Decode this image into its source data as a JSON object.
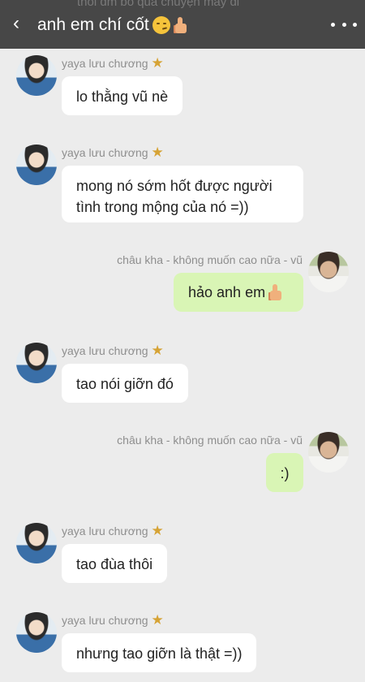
{
  "header": {
    "ghost_text": "thôi dm bỏ qua chuyện mày đi",
    "back_icon": "‹",
    "title": "anh em chí cốt"
  },
  "messages": [
    {
      "sender": "yaya lưu chương",
      "text": "lo thằng vũ nè",
      "side": "left"
    },
    {
      "sender": "yaya lưu chương",
      "text_line1": "mong nó sớm hốt được người",
      "text_line2": "tình trong mộng của nó =))",
      "side": "left"
    },
    {
      "sender": "châu kha - không muốn cao nữa -  vũ",
      "text": "hảo anh em",
      "side": "right"
    },
    {
      "sender": "yaya lưu chương",
      "text": "tao nói giỡn đó",
      "side": "left"
    },
    {
      "sender": "châu kha - không muốn cao nữa -  vũ",
      "text": ":)",
      "side": "right"
    },
    {
      "sender": "yaya lưu chương",
      "text": "tao đùa thôi",
      "side": "left"
    },
    {
      "sender": "yaya lưu chương",
      "text": "nhưng tao giỡn là thật =))",
      "side": "left"
    }
  ],
  "colors": {
    "header_bg": "#474747",
    "background": "#ececec",
    "incoming_bubble": "#ffffff",
    "outgoing_bubble": "#d9f5b5",
    "sender_text": "#8e8e8e"
  },
  "icons": {
    "back": "back-chevron-icon",
    "more": "more-dots-icon",
    "title_emoji_1": "smirk-emoji-icon",
    "title_emoji_2": "thumbs-up-emoji-icon",
    "sender_badge": "star-badge-icon"
  }
}
